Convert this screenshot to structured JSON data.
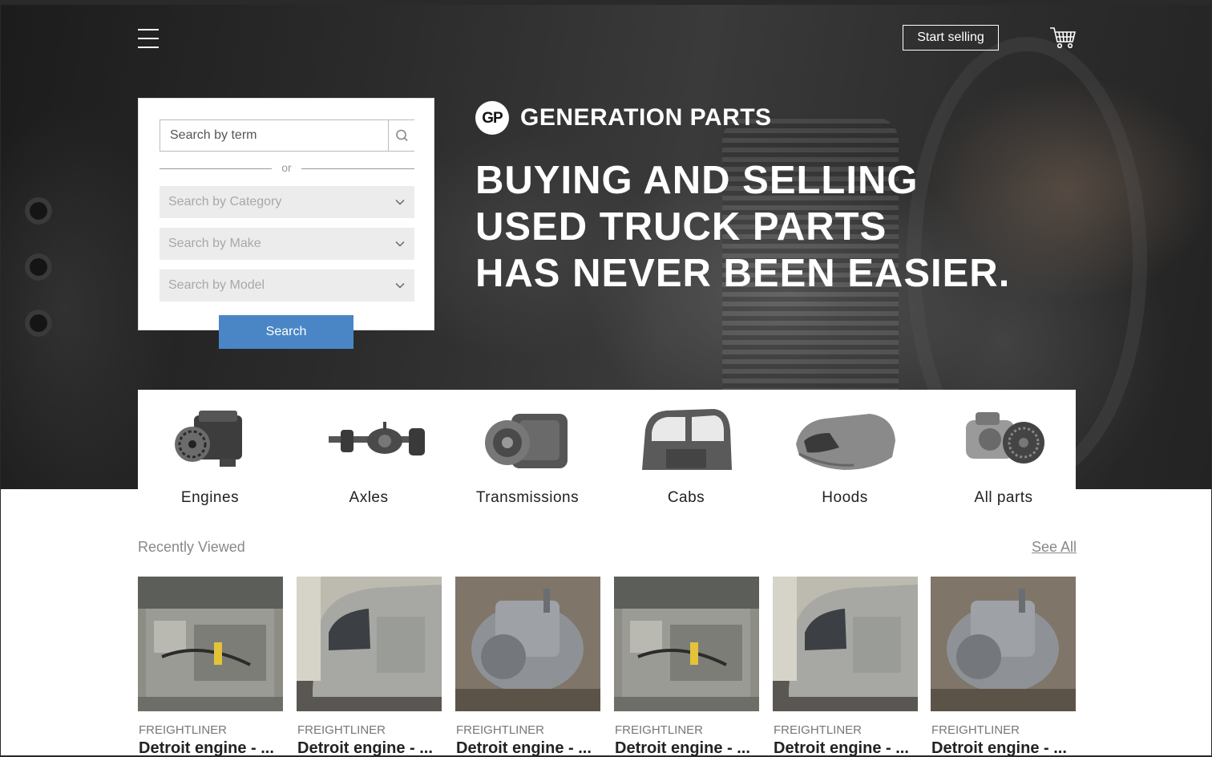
{
  "header": {
    "menu_icon": "hamburger-menu-icon",
    "start_selling_label": "Start selling",
    "cart_icon": "shopping-cart-icon"
  },
  "search": {
    "term_placeholder": "Search by term",
    "search_icon": "magnifier-icon",
    "or_label": "or",
    "category_label": "Search by Category",
    "make_label": "Search by Make",
    "model_label": "Search by Model",
    "button_label": "Search"
  },
  "brand": {
    "logo_text": "GP",
    "name": "GENERATION PARTS",
    "headline_line1": "BUYING AND SELLING",
    "headline_line2": "USED TRUCK PARTS",
    "headline_line3": "HAS NEVER BEEN EASIER."
  },
  "categories": [
    {
      "label": "Engines",
      "icon": "engine-icon"
    },
    {
      "label": "Axles",
      "icon": "axle-icon"
    },
    {
      "label": "Transmissions",
      "icon": "transmission-icon"
    },
    {
      "label": "Cabs",
      "icon": "cab-icon"
    },
    {
      "label": "Hoods",
      "icon": "hood-icon"
    },
    {
      "label": "All parts",
      "icon": "parts-icon"
    }
  ],
  "recently_viewed": {
    "title": "Recently Viewed",
    "see_all_label": "See All",
    "items": [
      {
        "brand": "FREIGHTLINER",
        "title": "Detroit engine - ...",
        "image": "engine-photo"
      },
      {
        "brand": "FREIGHTLINER",
        "title": "Detroit engine - ...",
        "image": "truck-cab-photo"
      },
      {
        "brand": "FREIGHTLINER",
        "title": "Detroit engine - ...",
        "image": "transmission-photo"
      },
      {
        "brand": "FREIGHTLINER",
        "title": "Detroit engine - ...",
        "image": "engine-photo"
      },
      {
        "brand": "FREIGHTLINER",
        "title": "Detroit engine - ...",
        "image": "truck-cab-photo"
      },
      {
        "brand": "FREIGHTLINER",
        "title": "Detroit engine - ...",
        "image": "transmission-photo"
      }
    ]
  },
  "colors": {
    "accent_button": "#4a86c5",
    "hero_text": "#ffffff",
    "muted_text": "#888888"
  }
}
